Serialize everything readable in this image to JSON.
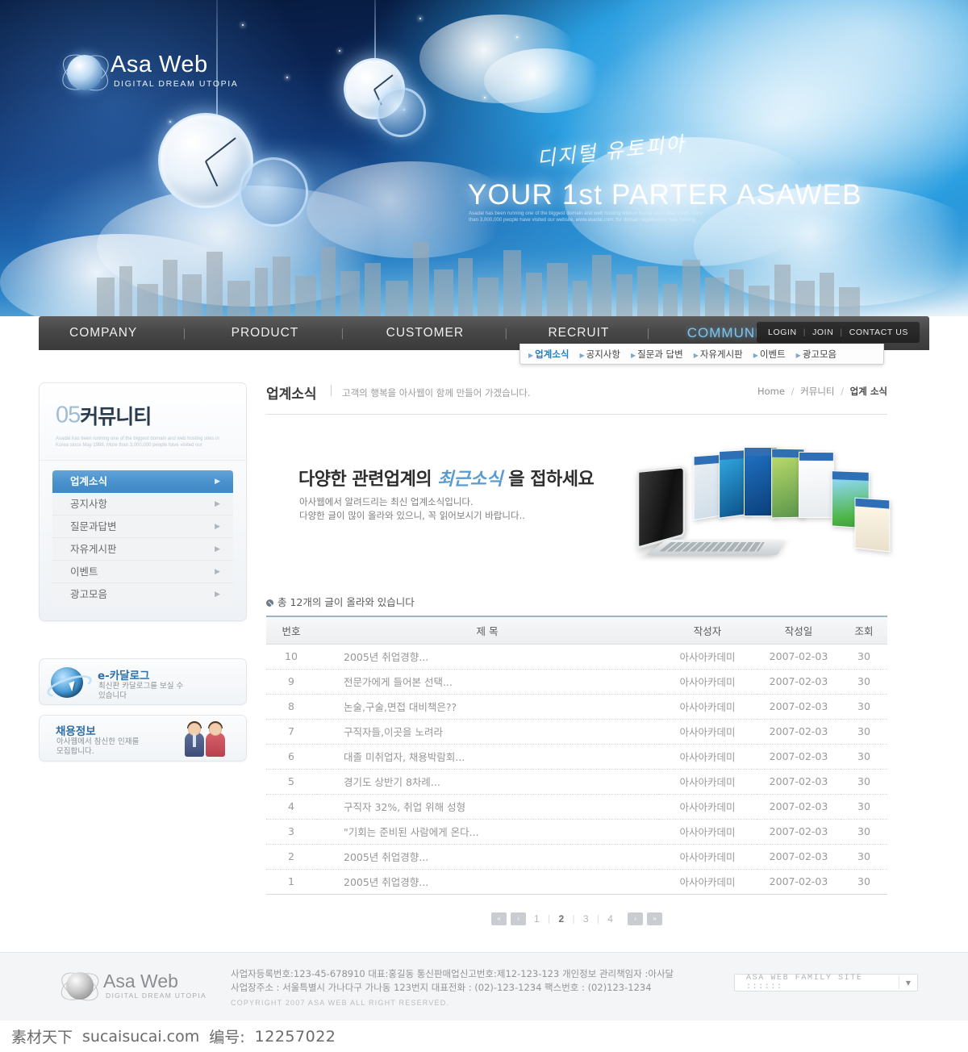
{
  "hero": {
    "logo_wordmark": "Asa Web",
    "logo_sub": "DIGITAL DREAM UTOPIA",
    "kr_script": "디지털 유토피아",
    "headline": "YOUR 1st PARTER ASAWEB",
    "desc": "Asadal has been running one of the biggest domain and web hosting sites in Korea since May 1998. More than 3,000,000 people have visited our website, www.asadal.com, for domain registration, web hosting."
  },
  "nav": {
    "items": [
      {
        "label": "COMPANY",
        "active": false
      },
      {
        "label": "PRODUCT",
        "active": false
      },
      {
        "label": "CUSTOMER",
        "active": false
      },
      {
        "label": "RECRUIT",
        "active": false
      },
      {
        "label": "COMMUNITY",
        "active": true
      }
    ],
    "utility": {
      "login": "LOGIN",
      "join": "JOIN",
      "contact": "CONTACT US",
      "divider": "|"
    },
    "subnav": [
      {
        "label": "업계소식",
        "active": true
      },
      {
        "label": "공지사항",
        "active": false
      },
      {
        "label": "질문과 답변",
        "active": false
      },
      {
        "label": "자유게시판",
        "active": false
      },
      {
        "label": "이벤트",
        "active": false
      },
      {
        "label": "광고모음",
        "active": false
      }
    ]
  },
  "sidebar": {
    "number": "05",
    "title": "커뮤니티",
    "desc": "Asadal has been running one of the biggest domain and web hosting sites in Korea since May 1998. More than 3,000,000 people have visited our",
    "items": [
      {
        "label": "업계소식",
        "active": true
      },
      {
        "label": "공지사항",
        "active": false
      },
      {
        "label": "질문과답변",
        "active": false
      },
      {
        "label": "자유게시판",
        "active": false
      },
      {
        "label": "이벤트",
        "active": false
      },
      {
        "label": "광고모음",
        "active": false
      }
    ],
    "banners": [
      {
        "title": "e-카달로그",
        "line1": "최신판 카달로그를 보실 수",
        "line2": "있습니다"
      },
      {
        "title": "채용정보",
        "line1": "아사웹에서 참신한 인재를",
        "line2": "모집합니다."
      }
    ]
  },
  "content": {
    "title": "업계소식",
    "subtitle": "고객의 행복을 아사웹이 함께 만들어 가겠습니다.",
    "breadcrumb": {
      "home": "Home",
      "level1": "커뮤니티",
      "level2": "업계 소식",
      "separator": "/"
    },
    "promo": {
      "head_before": "다양한 관련업계의",
      "head_accent": "최근소식",
      "head_after": "을 접하세요",
      "p1": "아사웹에서 알려드리는 최신 업계소식입니다.",
      "p2": "다양한 글이 많이 올라와 있으니, 꼭 읽어보시기 바랍니다.."
    },
    "count_text": "총 12개의 글이 올라와 있습니다",
    "table": {
      "headers": [
        "번호",
        "제 목",
        "작성자",
        "작성일",
        "조회"
      ],
      "rows": [
        {
          "no": "10",
          "subject": "2005년 취업경향...",
          "writer": "아사아카데미",
          "date": "2007-02-03",
          "hits": "30"
        },
        {
          "no": "9",
          "subject": "전문가에게 들어본 선택...",
          "writer": "아사아카데미",
          "date": "2007-02-03",
          "hits": "30"
        },
        {
          "no": "8",
          "subject": "논술,구술,면접 대비책은??",
          "writer": "아사아카데미",
          "date": "2007-02-03",
          "hits": "30"
        },
        {
          "no": "7",
          "subject": "구직자들,이곳을 노려라",
          "writer": "아사아카데미",
          "date": "2007-02-03",
          "hits": "30"
        },
        {
          "no": "6",
          "subject": "대졸 미취업자, 채용박람회...",
          "writer": "아사아카데미",
          "date": "2007-02-03",
          "hits": "30"
        },
        {
          "no": "5",
          "subject": "경기도 상반기 8차례...",
          "writer": "아사아카데미",
          "date": "2007-02-03",
          "hits": "30"
        },
        {
          "no": "4",
          "subject": "구직자 32%, 취업 위해 성형",
          "writer": "아사아카데미",
          "date": "2007-02-03",
          "hits": "30"
        },
        {
          "no": "3",
          "subject": "\"기회는 준비된 사람에게 온다...",
          "writer": "아사아카데미",
          "date": "2007-02-03",
          "hits": "30"
        },
        {
          "no": "2",
          "subject": "2005년 취업경향...",
          "writer": "아사아카데미",
          "date": "2007-02-03",
          "hits": "30"
        },
        {
          "no": "1",
          "subject": "2005년 취업경향...",
          "writer": "아사아카데미",
          "date": "2007-02-03",
          "hits": "30"
        }
      ]
    },
    "pager": {
      "first": "«",
      "prev": "‹",
      "next": "›",
      "last": "»",
      "pages": [
        {
          "label": "1",
          "active": false
        },
        {
          "label": "2",
          "active": true
        },
        {
          "label": "3",
          "active": false
        },
        {
          "label": "4",
          "active": false
        }
      ],
      "bar": "|"
    }
  },
  "footer": {
    "logo_wordmark": "Asa Web",
    "logo_sub": "DIGITAL DREAM UTOPIA",
    "line1": "사업자등록번호:123-45-678910 대표:홍길동 통신판매업신고번호:제12-123-123 개인정보 관리책임자 :아사달",
    "line2": "사업장주소 : 서울특별시 가나다구 가나동 123번지 대표전화 : (02)-123-1234 팩스번호 : (02)123-1234",
    "copyright": "COPYRIGHT 2007 ASA WEB  ALL RIGHT RESERVED.",
    "family_site": "ASA WEB FAMILY SITE ::::::",
    "family_arrow": "▼"
  },
  "watermark": {
    "site_cn": "素材天下",
    "site_url": "sucaisucai.com",
    "code_label": "编号:",
    "code_value": "12257022"
  },
  "colors": {
    "accent_blue": "#4a92cd",
    "nav_dark": "#474747",
    "link_blue": "#1f7fc4"
  }
}
